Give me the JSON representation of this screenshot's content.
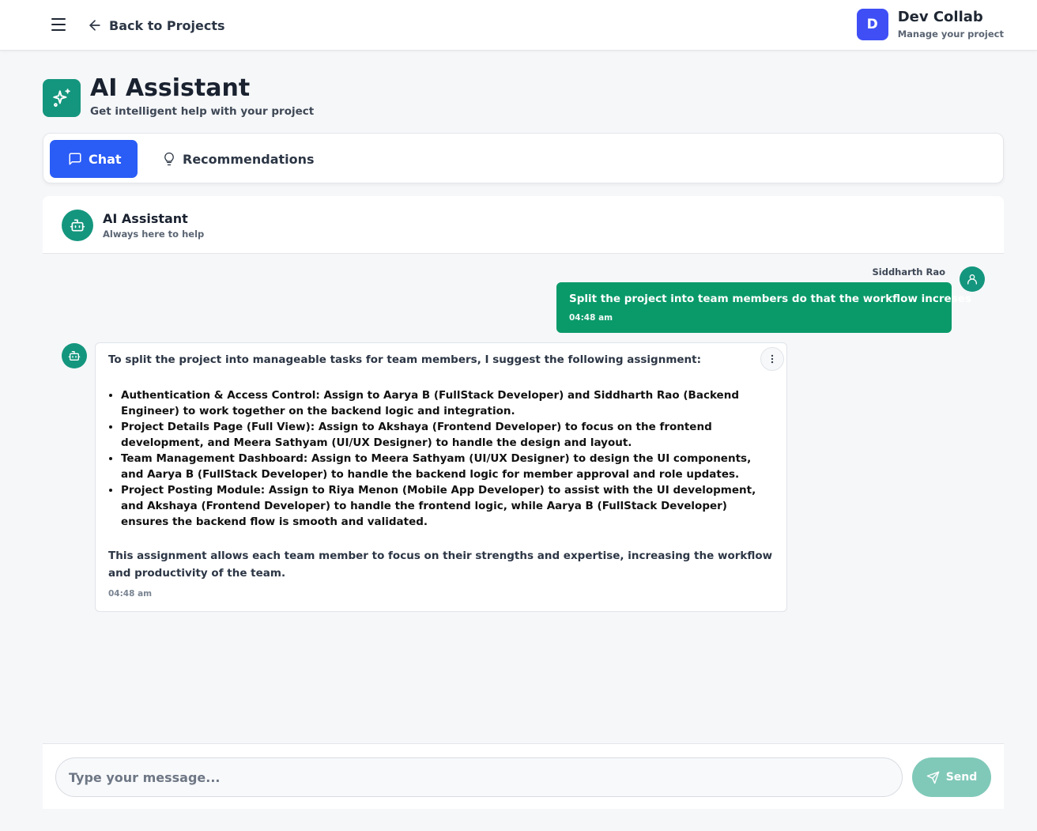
{
  "header": {
    "back_label": "Back to Projects",
    "brand_initial": "D",
    "brand_name": "Dev Collab",
    "brand_sub": "Manage your project"
  },
  "page": {
    "title": "AI Assistant",
    "subtitle": "Get intelligent help with your project"
  },
  "tabs": [
    {
      "label": "Chat",
      "icon": "message-square-icon",
      "active": true
    },
    {
      "label": "Recommendations",
      "icon": "lightbulb-icon",
      "active": false
    }
  ],
  "chat": {
    "title": "AI Assistant",
    "subtitle": "Always here to help",
    "messages": [
      {
        "sender": "Siddharth Rao",
        "text": "Split the project into team members do that the workflow increses",
        "time": "04:48 am"
      },
      {
        "sender": "bot",
        "intro": "To split the project into manageable tasks for team members, I suggest the following assignment:",
        "items": [
          "Authentication & Access Control: Assign to Aarya B (FullStack Developer) and Siddharth Rao (Backend Engineer) to work together on the backend logic and integration.",
          "Project Details Page (Full View): Assign to Akshaya (Frontend Developer) to focus on the frontend development, and Meera Sathyam (UI/UX Designer) to handle the design and layout.",
          "Team Management Dashboard: Assign to Meera Sathyam (UI/UX Designer) to design the UI components, and Aarya B (FullStack Developer) to handle the backend logic for member approval and role updates.",
          "Project Posting Module: Assign to Riya Menon (Mobile App Developer) to assist with the UI development, and Akshaya (Frontend Developer) to handle the frontend logic, while Aarya B (FullStack Developer) ensures the backend flow is smooth and validated."
        ],
        "outro": "This assignment allows each team member to focus on their strengths and expertise, increasing the workflow and productivity of the team.",
        "time": "04:48 am"
      }
    ]
  },
  "composer": {
    "placeholder": "Type your message...",
    "send_label": "Send"
  },
  "colors": {
    "accent_teal": "#14967e",
    "user_bubble": "#0a9a6a",
    "tab_active": "#2a5cf6",
    "brand": "#3f4ff5",
    "send_disabled": "#80c9b9"
  }
}
